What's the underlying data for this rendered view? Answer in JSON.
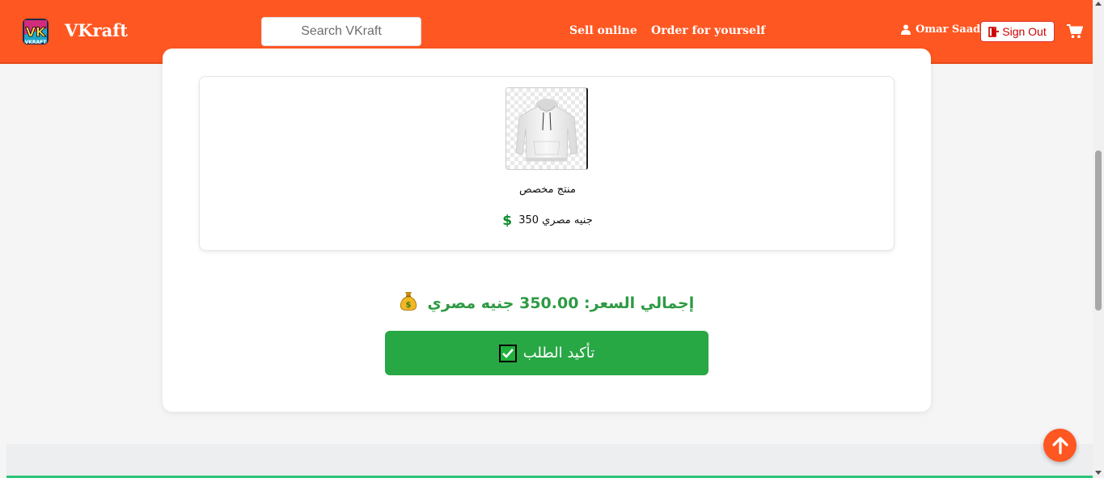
{
  "header": {
    "brand": "VKraft",
    "search_placeholder": "Search VKraft",
    "nav": [
      "Sell online",
      "Order for yourself"
    ],
    "user_name": "Omar Saad",
    "signout_label": "Sign Out",
    "colors": {
      "bar": "#ff5722",
      "signout": "#cc0000"
    }
  },
  "order": {
    "items": [
      {
        "name": "منتج مخصص",
        "price": "جنيه مصري 350",
        "image": "white-hoodie"
      }
    ],
    "total": "إجمالي السعر: 350.00 جنيه مصري",
    "confirm_label": "تأكيد الطلب",
    "accent": "#28a745"
  },
  "icons": [
    "user-icon",
    "signout-icon",
    "cart-icon",
    "dollar-icon",
    "money-bag-icon",
    "check-box-icon",
    "arrow-up-icon"
  ]
}
